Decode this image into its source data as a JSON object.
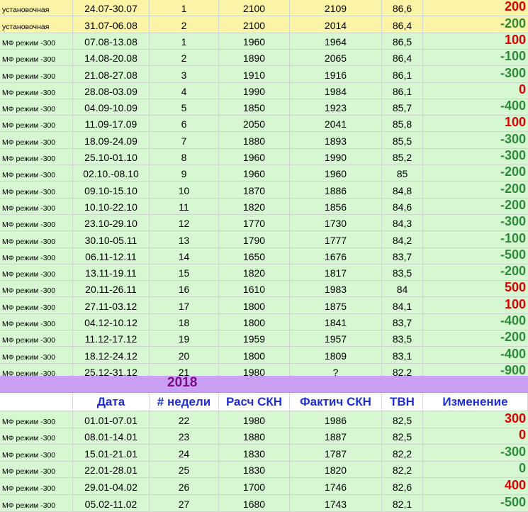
{
  "rows_top": [
    {
      "mode": "установочная",
      "date": "24.07-30.07",
      "week": "1",
      "calc": "2100",
      "fact": "2109",
      "tvn": "86,6",
      "change": "200",
      "color": "pos",
      "bg": "yellow"
    },
    {
      "mode": "установочная",
      "date": "31.07-06.08",
      "week": "2",
      "calc": "2100",
      "fact": "2014",
      "tvn": "86,4",
      "change": "-200",
      "color": "neg",
      "bg": "yellow"
    },
    {
      "mode": "МФ режим -300",
      "date": "07.08-13.08",
      "week": "1",
      "calc": "1960",
      "fact": "1964",
      "tvn": "86,5",
      "change": "100",
      "color": "pos",
      "bg": "green"
    },
    {
      "mode": "МФ режим -300",
      "date": "14.08-20.08",
      "week": "2",
      "calc": "1890",
      "fact": "2065",
      "tvn": "86,4",
      "change": "-100",
      "color": "neg",
      "bg": "green"
    },
    {
      "mode": "МФ режим -300",
      "date": "21.08-27.08",
      "week": "3",
      "calc": "1910",
      "fact": "1916",
      "tvn": "86,1",
      "change": "-300",
      "color": "neg",
      "bg": "green"
    },
    {
      "mode": "МФ режим -300",
      "date": "28.08-03.09",
      "week": "4",
      "calc": "1990",
      "fact": "1984",
      "tvn": "86,1",
      "change": "0",
      "color": "zero-red",
      "bg": "green"
    },
    {
      "mode": "МФ режим -300",
      "date": "04.09-10.09",
      "week": "5",
      "calc": "1850",
      "fact": "1923",
      "tvn": "85,7",
      "change": "-400",
      "color": "neg",
      "bg": "green"
    },
    {
      "mode": "МФ режим -300",
      "date": "11.09-17.09",
      "week": "6",
      "calc": "2050",
      "fact": "2041",
      "tvn": "85,8",
      "change": "100",
      "color": "pos",
      "bg": "green"
    },
    {
      "mode": "МФ режим -300",
      "date": "18.09-24.09",
      "week": "7",
      "calc": "1880",
      "fact": "1893",
      "tvn": "85,5",
      "change": "-300",
      "color": "neg",
      "bg": "green"
    },
    {
      "mode": "МФ режим -300",
      "date": "25.10-01.10",
      "week": "8",
      "calc": "1960",
      "fact": "1990",
      "tvn": "85,2",
      "change": "-300",
      "color": "neg",
      "bg": "green"
    },
    {
      "mode": "МФ режим -300",
      "date": "02.10.-08.10",
      "week": "9",
      "calc": "1960",
      "fact": "1960",
      "tvn": "85",
      "change": "-200",
      "color": "neg",
      "bg": "green"
    },
    {
      "mode": "МФ режим -300",
      "date": "09.10-15.10",
      "week": "10",
      "calc": "1870",
      "fact": "1886",
      "tvn": "84,8",
      "change": "-200",
      "color": "neg",
      "bg": "green"
    },
    {
      "mode": "МФ режим -300",
      "date": "10.10-22.10",
      "week": "11",
      "calc": "1820",
      "fact": "1856",
      "tvn": "84,6",
      "change": "-200",
      "color": "neg",
      "bg": "green"
    },
    {
      "mode": "МФ режим -300",
      "date": "23.10-29.10",
      "week": "12",
      "calc": "1770",
      "fact": "1730",
      "tvn": "84,3",
      "change": "-300",
      "color": "neg",
      "bg": "green"
    },
    {
      "mode": "МФ режим -300",
      "date": "30.10-05.11",
      "week": "13",
      "calc": "1790",
      "fact": "1777",
      "tvn": "84,2",
      "change": "-100",
      "color": "neg",
      "bg": "green"
    },
    {
      "mode": "МФ режим -300",
      "date": "06.11-12.11",
      "week": "14",
      "calc": "1650",
      "fact": "1676",
      "tvn": "83,7",
      "change": "-500",
      "color": "neg",
      "bg": "green"
    },
    {
      "mode": "МФ режим -300",
      "date": "13.11-19.11",
      "week": "15",
      "calc": "1820",
      "fact": "1817",
      "tvn": "83,5",
      "change": "-200",
      "color": "neg",
      "bg": "green"
    },
    {
      "mode": "МФ режим -300",
      "date": "20.11-26.11",
      "week": "16",
      "calc": "1610",
      "fact": "1983",
      "tvn": "84",
      "change": "500",
      "color": "pos",
      "bg": "green"
    },
    {
      "mode": "МФ режим -300",
      "date": "27.11-03.12",
      "week": "17",
      "calc": "1800",
      "fact": "1875",
      "tvn": "84,1",
      "change": "100",
      "color": "pos",
      "bg": "green"
    },
    {
      "mode": "МФ режим -300",
      "date": "04.12-10.12",
      "week": "18",
      "calc": "1800",
      "fact": "1841",
      "tvn": "83,7",
      "change": "-400",
      "color": "neg",
      "bg": "green"
    },
    {
      "mode": "МФ режим -300",
      "date": "11.12-17.12",
      "week": "19",
      "calc": "1959",
      "fact": "1957",
      "tvn": "83,5",
      "change": "-200",
      "color": "neg",
      "bg": "green"
    },
    {
      "mode": "МФ режим -300",
      "date": "18.12-24.12",
      "week": "20",
      "calc": "1800",
      "fact": "1809",
      "tvn": "83,1",
      "change": "-400",
      "color": "neg",
      "bg": "green"
    },
    {
      "mode": "МФ режим -300",
      "date": "25.12-31.12",
      "week": "21",
      "calc": "1980",
      "fact": "?",
      "tvn": "82,2",
      "change": "-900",
      "color": "neg",
      "bg": "green"
    }
  ],
  "year_label": "2018",
  "header": [
    "",
    "Дата",
    "# недели",
    "Расч СКН",
    "Фактич СКН",
    "ТВН",
    "Изменение"
  ],
  "rows_bottom": [
    {
      "mode": "МФ режим -300",
      "date": "01.01-07.01",
      "week": "22",
      "calc": "1980",
      "fact": "1986",
      "tvn": "82,5",
      "change": "300",
      "color": "pos",
      "bg": "green"
    },
    {
      "mode": "МФ режим -300",
      "date": "08.01-14.01",
      "week": "23",
      "calc": "1880",
      "fact": "1887",
      "tvn": "82,5",
      "change": "0",
      "color": "zero-red",
      "bg": "green"
    },
    {
      "mode": "МФ режим -300",
      "date": "15.01-21.01",
      "week": "24",
      "calc": "1830",
      "fact": "1787",
      "tvn": "82,2",
      "change": "-300",
      "color": "neg",
      "bg": "green"
    },
    {
      "mode": "МФ режим -300",
      "date": "22.01-28.01",
      "week": "25",
      "calc": "1830",
      "fact": "1820",
      "tvn": "82,2",
      "change": "0",
      "color": "zero-green",
      "bg": "green"
    },
    {
      "mode": "МФ режим -300",
      "date": "29.01-04.02",
      "week": "26",
      "calc": "1700",
      "fact": "1746",
      "tvn": "82,6",
      "change": "400",
      "color": "pos",
      "bg": "green"
    },
    {
      "mode": "МФ режим -300",
      "date": "05.02-11.02",
      "week": "27",
      "calc": "1680",
      "fact": "1743",
      "tvn": "82,1",
      "change": "-500",
      "color": "neg",
      "bg": "green"
    }
  ]
}
